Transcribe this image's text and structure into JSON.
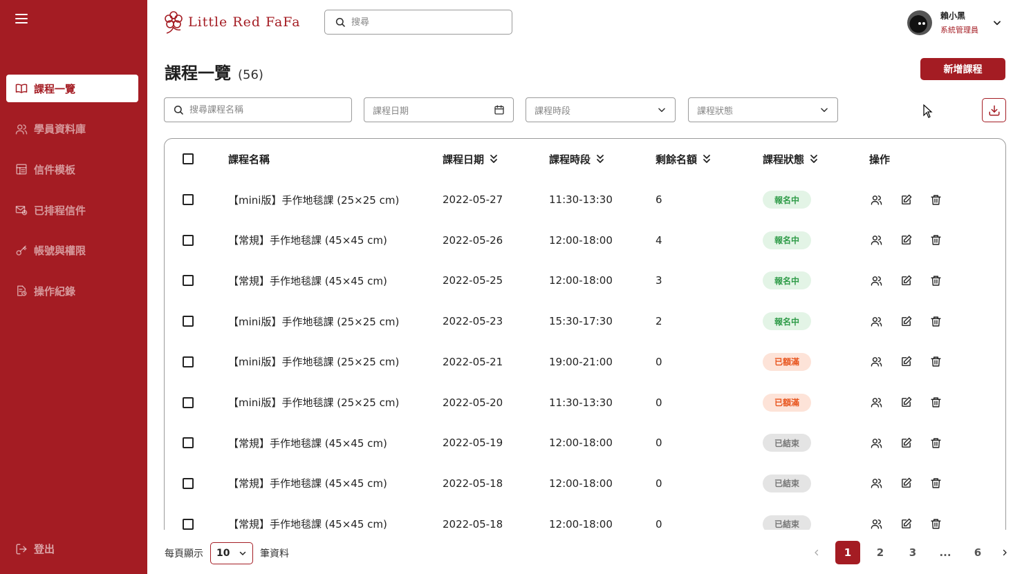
{
  "sidebar": {
    "items": [
      {
        "label": "課程一覽",
        "icon": "book-icon",
        "active": true
      },
      {
        "label": "學員資料庫",
        "icon": "users-icon",
        "active": false
      },
      {
        "label": "信件模板",
        "icon": "template-icon",
        "active": false
      },
      {
        "label": "已排程信件",
        "icon": "scheduled-mail-icon",
        "active": false
      },
      {
        "label": "帳號與權限",
        "icon": "key-icon",
        "active": false
      },
      {
        "label": "操作紀錄",
        "icon": "log-icon",
        "active": false
      }
    ],
    "logout_label": "登出"
  },
  "header": {
    "brand": "Little Red FaFa",
    "search_placeholder": "搜尋",
    "user_name": "賴小黑",
    "user_role": "系統管理員"
  },
  "page": {
    "title": "課程一覽",
    "count": "(56)",
    "add_button": "新增課程"
  },
  "filters": {
    "search_placeholder": "搜尋課程名稱",
    "date_placeholder": "課程日期",
    "time_placeholder": "課程時段",
    "status_placeholder": "課程狀態"
  },
  "table": {
    "headers": {
      "name": "課程名稱",
      "date": "課程日期",
      "time": "課程時段",
      "remaining": "剩餘名額",
      "status": "課程狀態",
      "actions": "操作"
    },
    "rows": [
      {
        "name": "【mini版】手作地毯課 (25×25 cm)",
        "date": "2022-05-27",
        "time": "11:30-13:30",
        "remaining": "6",
        "status": "報名中",
        "status_type": "open"
      },
      {
        "name": "【常規】手作地毯課 (45×45 cm)",
        "date": "2022-05-26",
        "time": "12:00-18:00",
        "remaining": "4",
        "status": "報名中",
        "status_type": "open"
      },
      {
        "name": "【常規】手作地毯課 (45×45 cm)",
        "date": "2022-05-25",
        "time": "12:00-18:00",
        "remaining": "3",
        "status": "報名中",
        "status_type": "open"
      },
      {
        "name": "【mini版】手作地毯課 (25×25 cm)",
        "date": "2022-05-23",
        "time": "15:30-17:30",
        "remaining": "2",
        "status": "報名中",
        "status_type": "open"
      },
      {
        "name": "【mini版】手作地毯課 (25×25 cm)",
        "date": "2022-05-21",
        "time": "19:00-21:00",
        "remaining": "0",
        "status": "已額滿",
        "status_type": "full"
      },
      {
        "name": "【mini版】手作地毯課 (25×25 cm)",
        "date": "2022-05-20",
        "time": "11:30-13:30",
        "remaining": "0",
        "status": "已額滿",
        "status_type": "full"
      },
      {
        "name": "【常規】手作地毯課 (45×45 cm)",
        "date": "2022-05-19",
        "time": "12:00-18:00",
        "remaining": "0",
        "status": "已結束",
        "status_type": "ended"
      },
      {
        "name": "【常規】手作地毯課 (45×45 cm)",
        "date": "2022-05-18",
        "time": "12:00-18:00",
        "remaining": "0",
        "status": "已結束",
        "status_type": "ended"
      },
      {
        "name": "【常規】手作地毯課 (45×45 cm)",
        "date": "2022-05-18",
        "time": "12:00-18:00",
        "remaining": "0",
        "status": "已結束",
        "status_type": "ended"
      }
    ]
  },
  "status_colors": {
    "open": {
      "bg": "#e3f4e6",
      "fg": "#2e9b48"
    },
    "full": {
      "bg": "#fde3d8",
      "fg": "#e8551e"
    },
    "ended": {
      "bg": "#e4e4e4",
      "fg": "#777777"
    }
  },
  "footer": {
    "per_page_label": "每頁顯示",
    "per_page_value": "10",
    "per_page_suffix": "筆資料",
    "pages": [
      "1",
      "2",
      "3",
      "...",
      "6"
    ],
    "current_page": "1"
  },
  "colors": {
    "brand": "#a41c23"
  }
}
